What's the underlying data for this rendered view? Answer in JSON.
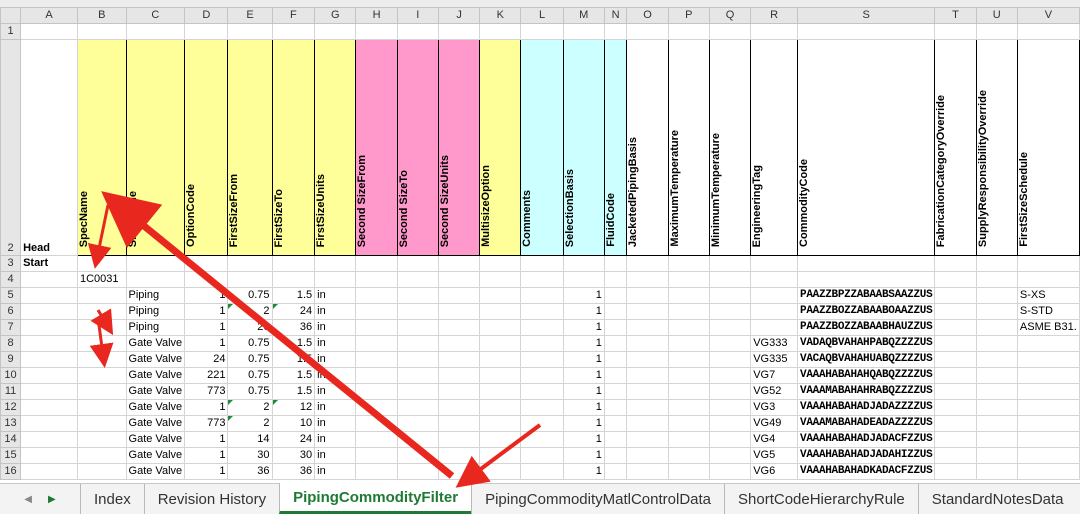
{
  "columns": [
    "A",
    "B",
    "C",
    "D",
    "E",
    "F",
    "G",
    "H",
    "I",
    "J",
    "K",
    "L",
    "M",
    "N",
    "O",
    "P",
    "Q",
    "R",
    "S",
    "T",
    "U",
    "V"
  ],
  "header_label": "Head",
  "headers": [
    {
      "col": "B",
      "text": "SpecName",
      "color": "yellow"
    },
    {
      "col": "C",
      "text": "ShortCode",
      "color": "yellow"
    },
    {
      "col": "D",
      "text": "OptionCode",
      "color": "yellow"
    },
    {
      "col": "E",
      "text": "FirstSizeFrom",
      "color": "yellow"
    },
    {
      "col": "F",
      "text": "FirstSizeTo",
      "color": "yellow"
    },
    {
      "col": "G",
      "text": "FirstSizeUnits",
      "color": "yellow"
    },
    {
      "col": "H",
      "text": "Second SizeFrom",
      "color": "pink"
    },
    {
      "col": "I",
      "text": "Second SizeTo",
      "color": "pink"
    },
    {
      "col": "J",
      "text": "Second SizeUnits",
      "color": "pink"
    },
    {
      "col": "K",
      "text": "MultisizeOption",
      "color": "yellow"
    },
    {
      "col": "L",
      "text": "Comments",
      "color": "cyan"
    },
    {
      "col": "M",
      "text": "SelectionBasis",
      "color": "cyan"
    },
    {
      "col": "N",
      "text": "FluidCode",
      "color": "cyan"
    },
    {
      "col": "O",
      "text": "JacketedPipingBasis",
      "color": "white"
    },
    {
      "col": "P",
      "text": "MaximumTemperature",
      "color": "white"
    },
    {
      "col": "Q",
      "text": "MinimumTemperature",
      "color": "white"
    },
    {
      "col": "R",
      "text": "EngineeringTag",
      "color": "white"
    },
    {
      "col": "S",
      "text": "CommodityCode",
      "color": "white"
    },
    {
      "col": "T",
      "text": "FabricationCategoryOverride",
      "color": "white"
    },
    {
      "col": "U",
      "text": "SupplyResponsibilityOverride",
      "color": "white"
    },
    {
      "col": "V",
      "text": "FirstSizeSchedule",
      "color": "white"
    }
  ],
  "start_label": "Start",
  "spec_name": "1C0031",
  "rows": [
    {
      "n": "5",
      "short": "Piping",
      "opt": "1",
      "from": "0.75",
      "to": "1.5",
      "units": "in",
      "sel": "1",
      "tag": "",
      "code": "PAAZZBPZZABAABSAAZZUS",
      "sched": "S-XS"
    },
    {
      "n": "6",
      "short": "Piping",
      "opt": "1",
      "from": "2",
      "to": "24",
      "units": "in",
      "sel": "1",
      "tag": "",
      "code": "PAAZZBOZZABAABOAAZZUS",
      "sched": "S-STD"
    },
    {
      "n": "7",
      "short": "Piping",
      "opt": "1",
      "from": "26",
      "to": "36",
      "units": "in",
      "sel": "1",
      "tag": "",
      "code": "PAAZZBOZZABAABHAUZZUS",
      "sched": "ASME B31."
    },
    {
      "n": "8",
      "short": "Gate Valve",
      "opt": "1",
      "from": "0.75",
      "to": "1.5",
      "units": "in",
      "sel": "1",
      "tag": "VG333",
      "code": "VADAQBVAHAHPABQZZZZUS",
      "sched": ""
    },
    {
      "n": "9",
      "short": "Gate Valve",
      "opt": "24",
      "from": "0.75",
      "to": "1.5",
      "units": "in",
      "sel": "1",
      "tag": "VG335",
      "code": "VACAQBVAHAHUABQZZZZUS",
      "sched": ""
    },
    {
      "n": "10",
      "short": "Gate Valve",
      "opt": "221",
      "from": "0.75",
      "to": "1.5",
      "units": "in",
      "sel": "1",
      "tag": "VG7",
      "code": "VAAAHABAHAHQABQZZZZUS",
      "sched": ""
    },
    {
      "n": "11",
      "short": "Gate Valve",
      "opt": "773",
      "from": "0.75",
      "to": "1.5",
      "units": "in",
      "sel": "1",
      "tag": "VG52",
      "code": "VAAAMABAHAHRABQZZZZUS",
      "sched": ""
    },
    {
      "n": "12",
      "short": "Gate Valve",
      "opt": "1",
      "from": "2",
      "to": "12",
      "units": "in",
      "sel": "1",
      "tag": "VG3",
      "code": "VAAAHABAHADJADAZZZZUS",
      "sched": ""
    },
    {
      "n": "13",
      "short": "Gate Valve",
      "opt": "773",
      "from": "2",
      "to": "10",
      "units": "in",
      "sel": "1",
      "tag": "VG49",
      "code": "VAAAMABAHADEADAZZZZUS",
      "sched": ""
    },
    {
      "n": "14",
      "short": "Gate Valve",
      "opt": "1",
      "from": "14",
      "to": "24",
      "units": "in",
      "sel": "1",
      "tag": "VG4",
      "code": "VAAAHABAHADJADACFZZUS",
      "sched": ""
    },
    {
      "n": "15",
      "short": "Gate Valve",
      "opt": "1",
      "from": "30",
      "to": "30",
      "units": "in",
      "sel": "1",
      "tag": "VG5",
      "code": "VAAAHABAHADJADAHIZZUS",
      "sched": ""
    },
    {
      "n": "16",
      "short": "Gate Valve",
      "opt": "1",
      "from": "36",
      "to": "36",
      "units": "in",
      "sel": "1",
      "tag": "VG6",
      "code": "VAAAHABAHADKADACFZZUS",
      "sched": ""
    }
  ],
  "tabs": [
    "Index",
    "Revision History",
    "PipingCommodityFilter",
    "PipingCommodityMatlControlData",
    "ShortCodeHierarchyRule",
    "StandardNotesData"
  ],
  "active_tab": "PipingCommodityFilter",
  "colors": {
    "yellow": "#ffff99",
    "pink": "#ff99cc",
    "cyan": "#ccffff",
    "accent_green": "#1e7a34",
    "arrow_red": "#e8281e"
  }
}
